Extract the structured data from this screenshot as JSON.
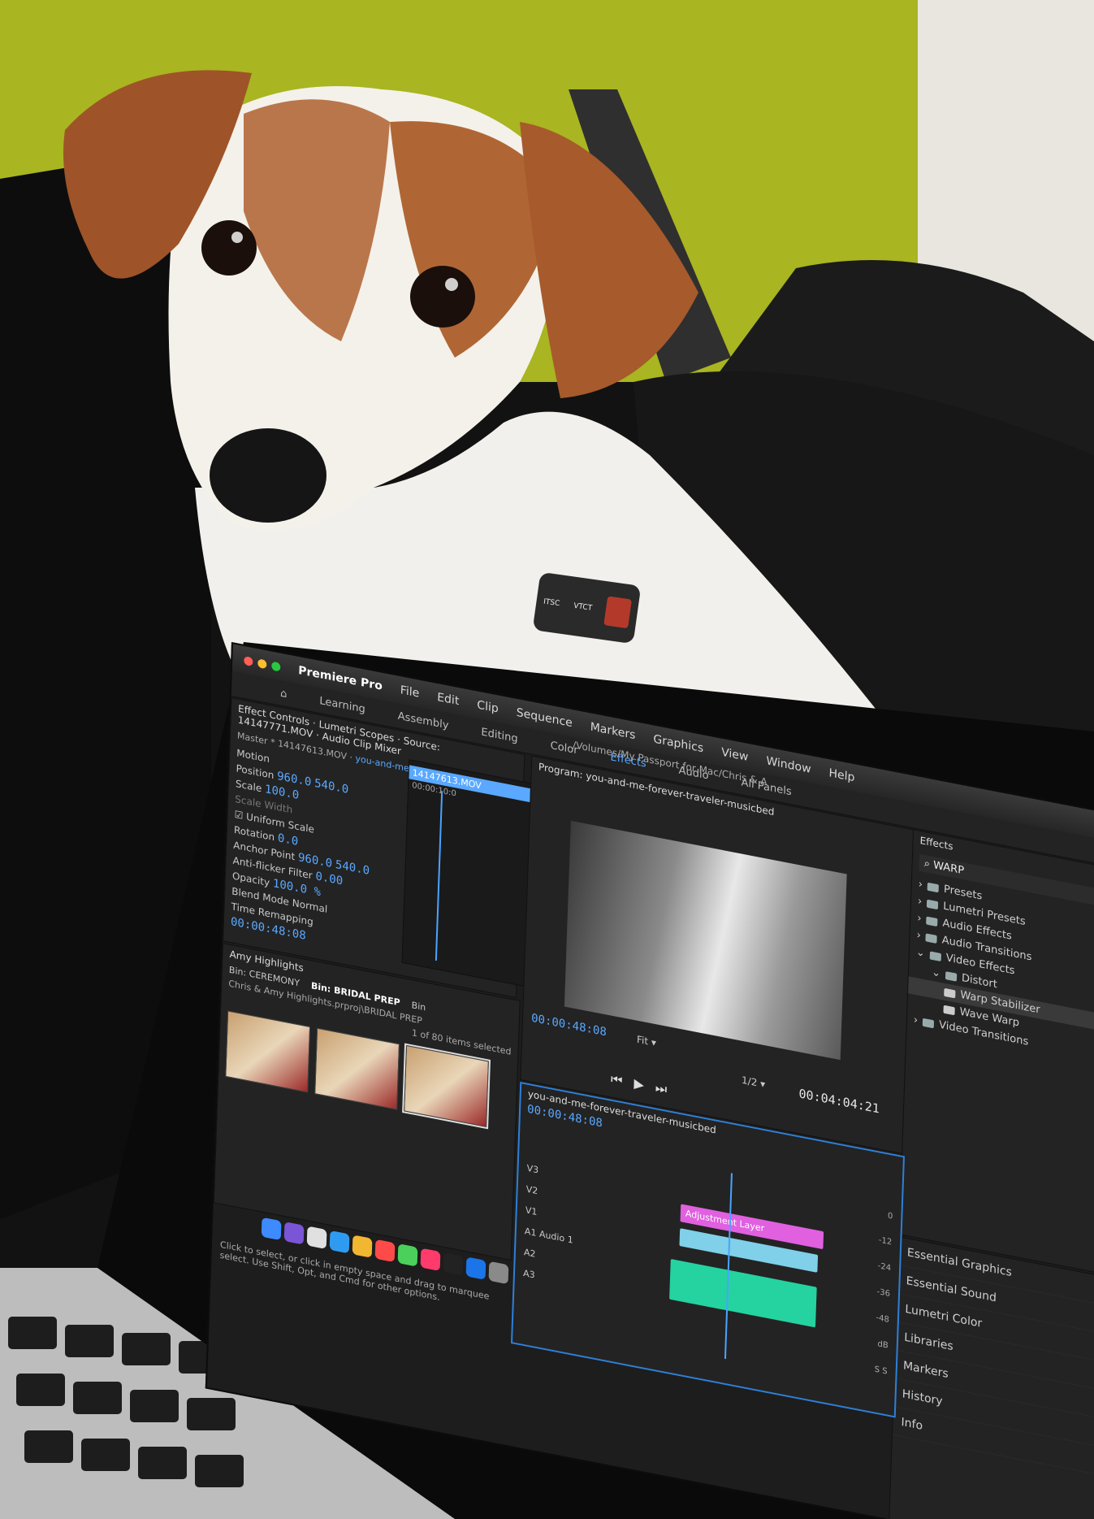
{
  "menubar": {
    "app": "Premiere Pro",
    "items": [
      "File",
      "Edit",
      "Clip",
      "Sequence",
      "Markers",
      "Graphics",
      "View",
      "Window",
      "Help"
    ]
  },
  "path": "/Volumes/My Passport for Mac/Chris & A",
  "workspaces": [
    "Learning",
    "Assembly",
    "Editing",
    "Color",
    "Effects",
    "Audio",
    "All Panels"
  ],
  "active_workspace": "Effects",
  "effect_controls": {
    "tabs": [
      "Effect Controls",
      "Lumetri Scopes",
      "Source: 14147771.MOV",
      "Audio Clip Mixer"
    ],
    "master": "Master * 14147613.MOV",
    "sequence": "you-and-me-forever-tr...",
    "clip_label": "14147613.MOV",
    "clip_time": "00:00:10:0",
    "rows": [
      "Motion",
      "Position",
      "Scale",
      "Scale Width",
      "Rotation",
      "Anchor Point",
      "Anti-flicker Filter",
      "Opacity",
      "Blend Mode",
      "Time Remapping"
    ],
    "values": [
      "960.0",
      "540.0",
      "100.0",
      "0.0",
      "960.0",
      "540.0",
      "0.00",
      "100.0 %",
      "Normal"
    ],
    "uniform_scale": "Uniform Scale",
    "timecode": "00:00:48:08"
  },
  "program": {
    "title": "Program: you-and-me-forever-traveler-musicbed",
    "timecode_left": "00:00:48:08",
    "fit": "Fit",
    "page": "1/2",
    "timecode_right": "00:04:04:21"
  },
  "effects_panel": {
    "title": "Effects",
    "search_value": "WARP",
    "tree": [
      "Presets",
      "Lumetri Presets",
      "Audio Effects",
      "Audio Transitions",
      "Video Effects",
      "Distort",
      "Warp Stabilizer",
      "Wave Warp",
      "Video Transitions"
    ],
    "selected": "Warp Stabilizer"
  },
  "side_panels": [
    "Essential Graphics",
    "Essential Sound",
    "Lumetri Color",
    "Libraries",
    "Markers",
    "History",
    "Info"
  ],
  "project": {
    "title": "Amy Highlights",
    "bins": [
      "Bin: CEREMONY",
      "Bin: BRIDAL PREP",
      "Bin"
    ],
    "breadcrumb": "Chris & Amy Highlights.prproj\\BRIDAL PREP",
    "count": "1 of 80 items selected",
    "status": "Click to select, or click in empty space and drag to marquee select. Use Shift, Opt, and Cmd for other options."
  },
  "timeline": {
    "title": "you-and-me-forever-traveler-musicbed",
    "timecode": "00:00:48:08",
    "tracks": [
      "V3",
      "V2",
      "V1",
      "A1",
      "A2",
      "A3"
    ],
    "audio_label": "Audio 1",
    "adjustment_clip": "Adjustment Layer"
  },
  "meter_ticks": [
    "0",
    "-12",
    "-24",
    "-36",
    "-48",
    "dB"
  ],
  "meter_footer": [
    "S",
    "S"
  ],
  "webcam_cover": [
    "ITSC",
    "VTCT"
  ],
  "colors": {
    "accent": "#2e7fd6",
    "wall": "#a9b521",
    "adjustment": "#e060e0",
    "audio_clip": "#24d3a0"
  }
}
